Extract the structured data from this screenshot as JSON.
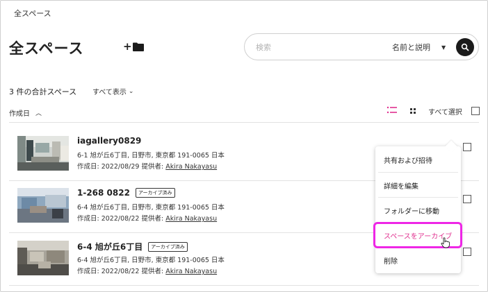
{
  "breadcrumb": "全スペース",
  "page_title": "全スペース",
  "new_folder": {
    "label": "+"
  },
  "search": {
    "placeholder": "検索",
    "scope_label": "名前と説明"
  },
  "summary": {
    "count_text": "3 件の合計スペース",
    "show_all": "すべて表示"
  },
  "sort": {
    "label": "作成日"
  },
  "toolbar": {
    "select_all": "すべて選択"
  },
  "colors": {
    "accent": "#e0308f",
    "highlight": "#ee26e6",
    "dark": "#1b1b1b"
  },
  "spaces": [
    {
      "title": "iagallery0829",
      "badge": "",
      "address": "6-1 旭が丘6丁目, 日野市, 東京都 191-0065 日本",
      "meta_prefix": "作成日: 2022/08/29 提供者: ",
      "provider": "Akira Nakayasu"
    },
    {
      "title": "1-268 0822",
      "badge": "アーカイブ済み",
      "address": "6-4 旭が丘6丁目, 日野市, 東京都 191-0065 日本",
      "meta_prefix": "作成日: 2022/08/22 提供者: ",
      "provider": "Akira Nakayasu"
    },
    {
      "title": "6-4 旭が丘6丁目",
      "badge": "アーカイブ済み",
      "address": "6-4 旭が丘6丁目, 日野市, 東京都 191-0065 日本",
      "meta_prefix": "作成日: 2022/08/22 提供者: ",
      "provider": "Akira Nakayasu"
    }
  ],
  "context_menu": {
    "items": [
      "共有および招待",
      "詳細を編集",
      "フォルダーに移動",
      "スペースをアーカイブ",
      "削除"
    ]
  }
}
